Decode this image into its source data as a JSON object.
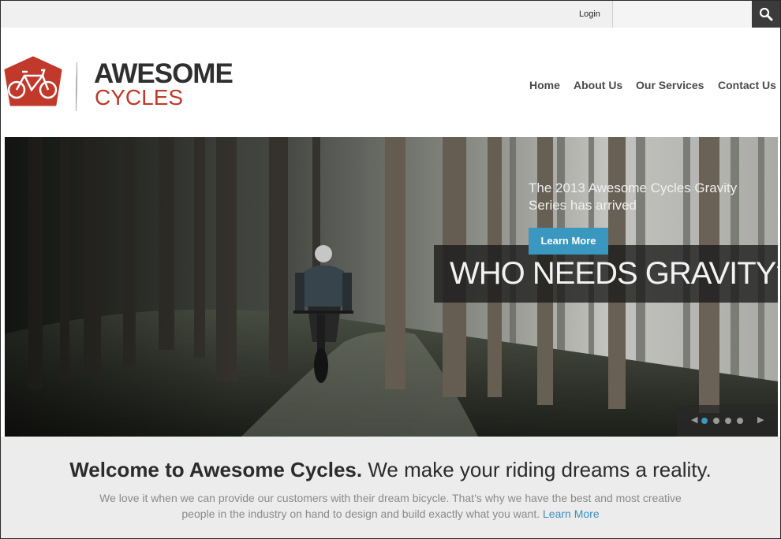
{
  "topbar": {
    "login_label": "Login",
    "search": {
      "placeholder": "",
      "icon": "search-icon"
    }
  },
  "brand": {
    "line1": "AWESOME",
    "line2": "CYCLES",
    "icon": "bicycle-logo-icon",
    "colors": {
      "red": "#c0392b",
      "dark": "#2f2f2f"
    }
  },
  "nav": {
    "items": [
      {
        "label": "Home"
      },
      {
        "label": "About Us"
      },
      {
        "label": "Our Services"
      },
      {
        "label": "Contact Us"
      }
    ]
  },
  "hero": {
    "title": "WHO NEEDS GRAVITY?",
    "subtitle": "The 2013 Awesome Cycles Gravity Series has arrived",
    "button_label": "Learn More",
    "button_color": "#3a97c0",
    "slides": {
      "total": 4,
      "active": 1
    },
    "prev_icon": "chevron-left-icon",
    "next_icon": "chevron-right-icon"
  },
  "welcome": {
    "heading_bold": "Welcome to Awesome Cycles.",
    "heading_rest": " We make your riding dreams a reality.",
    "body": "We love it when we can provide our customers with their dream bicycle. That’s why we have the best and most creative people in the industry on hand to design and build exactly what you want.",
    "link_label": "Learn More",
    "link_color": "#3a8fc0"
  }
}
